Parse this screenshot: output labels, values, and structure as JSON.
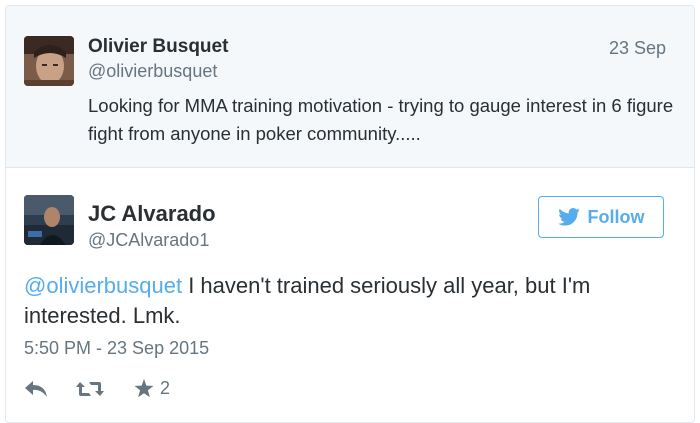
{
  "parent_tweet": {
    "author_name": "Olivier Busquet",
    "author_handle": "@olivierbusquet",
    "date": "23 Sep",
    "text": "Looking for MMA training motivation - trying to gauge interest in 6 figure fight from anyone in poker community....."
  },
  "main_tweet": {
    "author_name": "JC Alvarado",
    "author_handle": "@JCAlvarado1",
    "follow_label": "Follow",
    "mention": "@olivierbusquet",
    "text": " I haven't trained seriously all year, but I'm interested.  Lmk.",
    "timestamp": "5:50 PM - 23 Sep 2015",
    "like_count": "2"
  },
  "colors": {
    "accent": "#55acee",
    "text": "#292f33",
    "muted": "#66757f",
    "parent_bg": "#f5f8fa",
    "border": "#e1e8ed"
  },
  "icons": [
    "reply-icon",
    "retweet-icon",
    "star-icon",
    "twitter-bird-icon"
  ]
}
